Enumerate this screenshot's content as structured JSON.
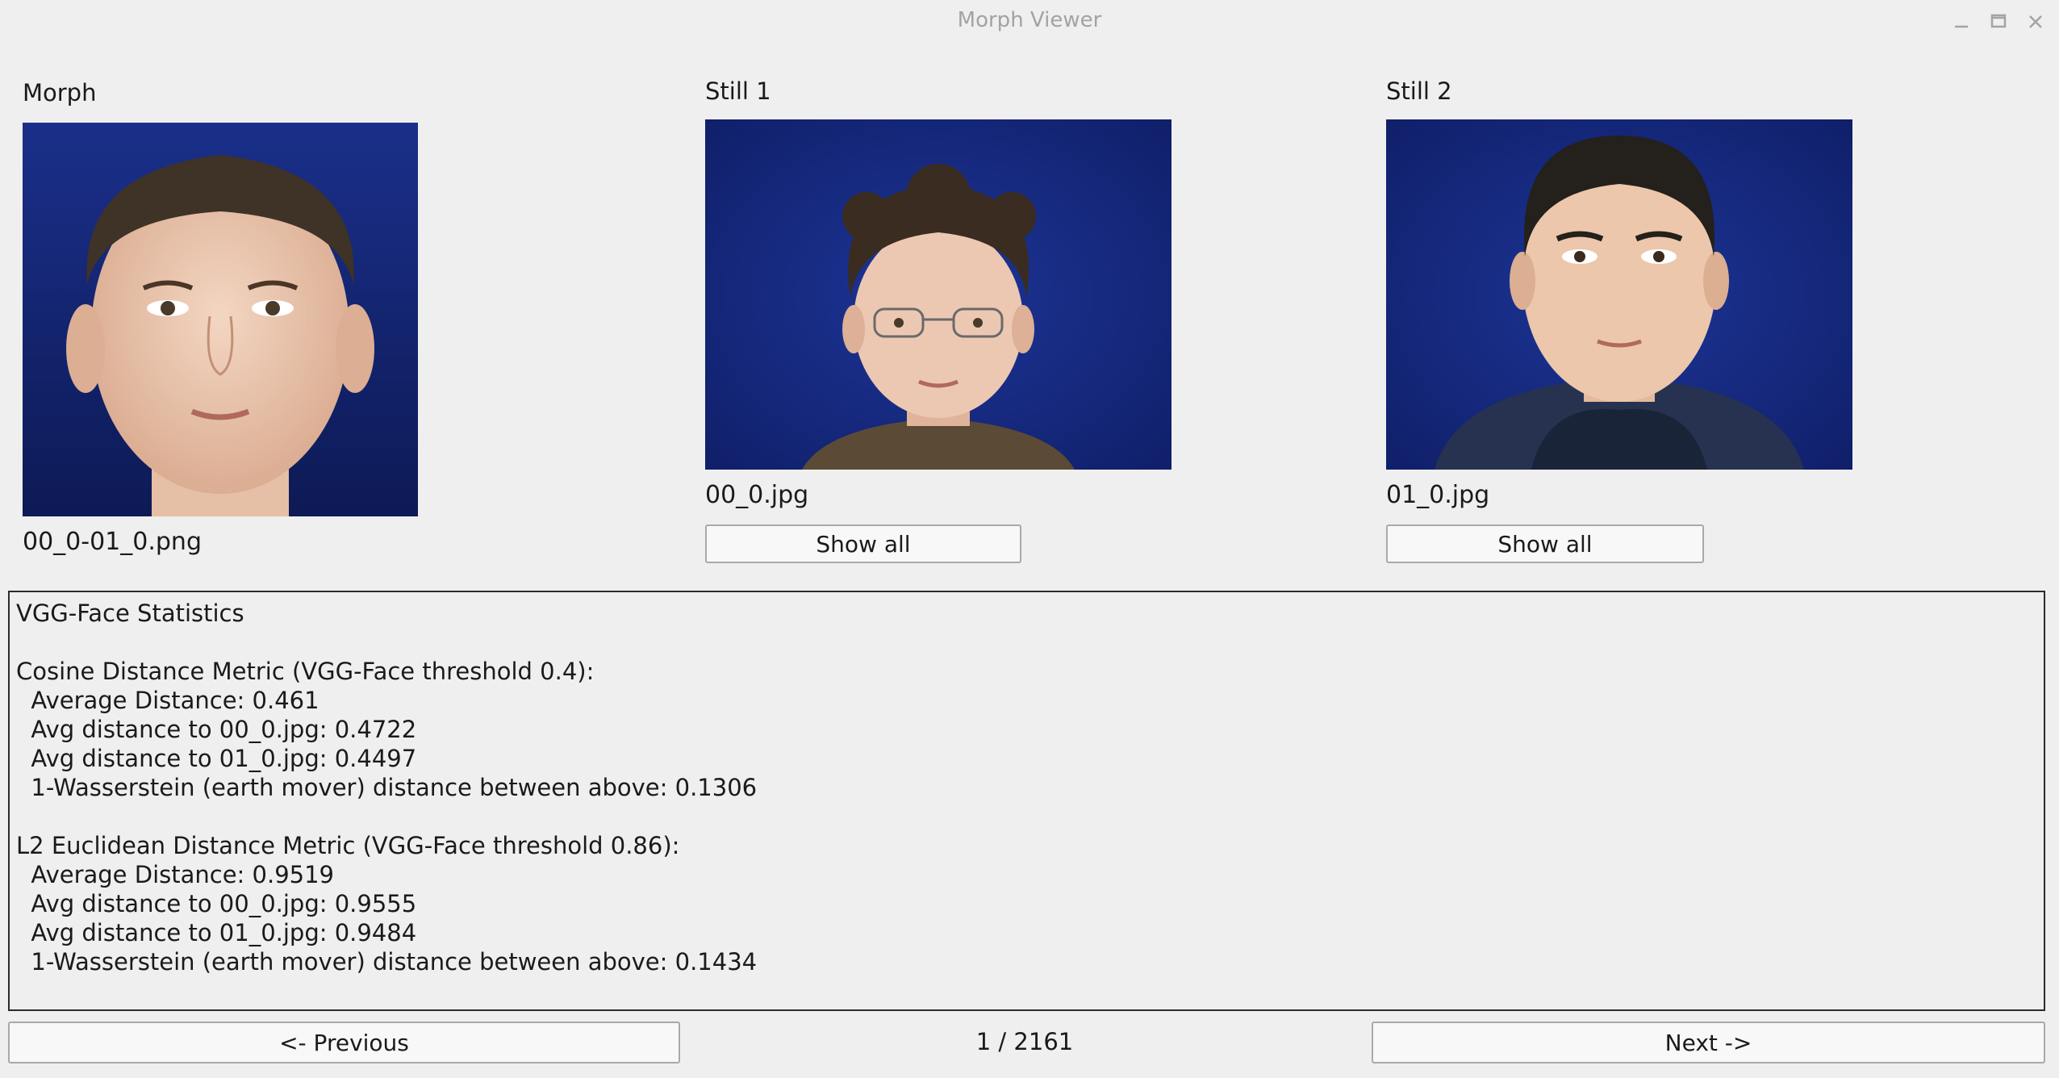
{
  "window": {
    "title": "Morph Viewer",
    "controls": [
      "minimize-icon",
      "maximize-icon",
      "close-icon"
    ]
  },
  "panels": {
    "morph": {
      "label": "Morph",
      "filename": "00_0-01_0.png"
    },
    "still1": {
      "label": "Still 1",
      "filename": "00_0.jpg",
      "button_label": "Show all"
    },
    "still2": {
      "label": "Still 2",
      "filename": "01_0.jpg",
      "button_label": "Show all"
    }
  },
  "colors": {
    "photo_background": "#132a86",
    "window_background": "#efefef"
  },
  "stats": {
    "lines": [
      "VGG-Face Statistics",
      "",
      "Cosine Distance Metric (VGG-Face threshold 0.4):",
      "  Average Distance: 0.461",
      "  Avg distance to 00_0.jpg: 0.4722",
      "  Avg distance to 01_0.jpg: 0.4497",
      "  1-Wasserstein (earth mover) distance between above: 0.1306",
      "",
      "L2 Euclidean Distance Metric (VGG-Face threshold 0.86):",
      "  Average Distance: 0.9519",
      "  Avg distance to 00_0.jpg: 0.9555",
      "  Avg distance to 01_0.jpg: 0.9484",
      "  1-Wasserstein (earth mover) distance between above: 0.1434"
    ]
  },
  "navigation": {
    "previous_label": "<- Previous",
    "next_label": "Next ->",
    "page_counter": "1 / 2161"
  }
}
